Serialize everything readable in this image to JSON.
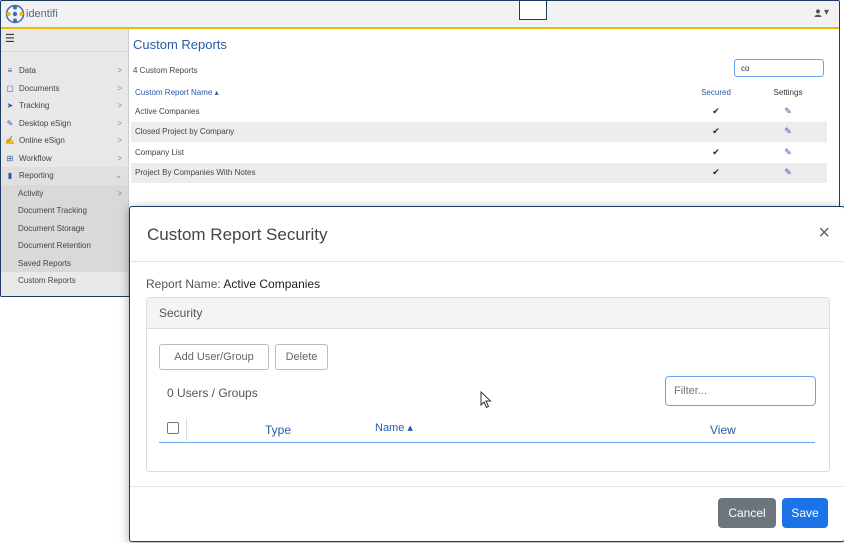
{
  "app": {
    "logo_text": "identifi",
    "user_icon": "user-icon",
    "user_chevron": "▾"
  },
  "sidebar": {
    "menu_icon": "☰",
    "items": [
      {
        "label": "Data",
        "icon": "database-icon",
        "glyph": "≡",
        "chevron": ">"
      },
      {
        "label": "Documents",
        "icon": "document-icon",
        "glyph": "▢",
        "chevron": ">"
      },
      {
        "label": "Tracking",
        "icon": "send-icon",
        "glyph": "➤",
        "chevron": ">"
      },
      {
        "label": "Desktop eSign",
        "icon": "pen-icon",
        "glyph": "✎",
        "chevron": ">"
      },
      {
        "label": "Online eSign",
        "icon": "signature-icon",
        "glyph": "✍",
        "chevron": ">"
      },
      {
        "label": "Workflow",
        "icon": "sitemap-icon",
        "glyph": "⊞",
        "chevron": ">"
      },
      {
        "label": "Reporting",
        "icon": "file-icon",
        "glyph": "▮",
        "chevron": "⌄"
      }
    ],
    "sub_items": [
      {
        "label": "Activity",
        "chevron": ">"
      },
      {
        "label": "Document Tracking",
        "chevron": ""
      },
      {
        "label": "Document Storage",
        "chevron": ""
      },
      {
        "label": "Document Retention",
        "chevron": ""
      },
      {
        "label": "Saved Reports",
        "chevron": ""
      },
      {
        "label": "Custom Reports",
        "chevron": ""
      }
    ]
  },
  "main": {
    "title": "Custom Reports",
    "count_text": "4 Custom Reports",
    "search_value": "co",
    "columns": {
      "name": "Custom Report Name ▴",
      "secured": "Secured",
      "settings": "Settings"
    },
    "rows": [
      {
        "name": "Active Companies",
        "secured": "✔",
        "settings": "✎"
      },
      {
        "name": "Closed Project by Company",
        "secured": "✔",
        "settings": "✎"
      },
      {
        "name": "Company List",
        "secured": "✔",
        "settings": "✎"
      },
      {
        "name": "Project By Companies With Notes",
        "secured": "✔",
        "settings": "✎"
      }
    ]
  },
  "modal": {
    "title": "Custom Report Security",
    "close_glyph": "×",
    "report_name_label": "Report Name:",
    "report_name_value": "Active Companies",
    "section_title": "Security",
    "add_button": "Add User/Group",
    "delete_button": "Delete",
    "users_count": "0 Users / Groups",
    "filter_placeholder": "Filter...",
    "columns": {
      "type": "Type",
      "name": "Name ▴",
      "view": "View"
    },
    "cancel_button": "Cancel",
    "save_button": "Save"
  },
  "colors": {
    "accent": "#2b5aa8",
    "topbar_border": "#f2b705",
    "primary_button": "#1a73e8",
    "secondary_button": "#6c757d"
  }
}
